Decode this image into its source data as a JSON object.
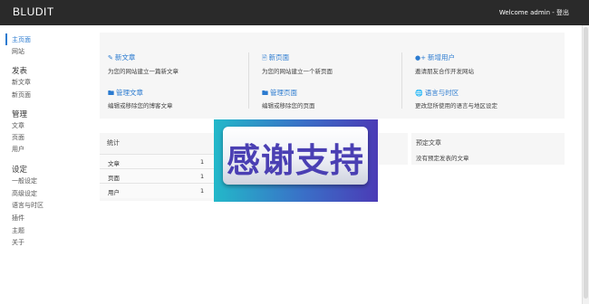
{
  "header": {
    "brand": "BLUDIT",
    "welcome_text": "Welcome admin - ",
    "logout_label": "登出"
  },
  "sidebar": {
    "items": [
      {
        "label": "主页面",
        "active": true
      },
      {
        "label": "网站"
      },
      {
        "label": "发表",
        "heading": true
      },
      {
        "label": "新文章"
      },
      {
        "label": "新页面"
      },
      {
        "label": "管理",
        "heading": true
      },
      {
        "label": "文章"
      },
      {
        "label": "页面"
      },
      {
        "label": "用户"
      },
      {
        "label": "设定",
        "heading": true
      },
      {
        "label": "一般设定"
      },
      {
        "label": "高级设定"
      },
      {
        "label": "语言与时区"
      },
      {
        "label": "插件"
      },
      {
        "label": "主题"
      },
      {
        "label": "关于"
      }
    ]
  },
  "quick_links": [
    {
      "title": "新文章",
      "icon": "pencil-icon",
      "desc": "为您的网站建立一篇新文章"
    },
    {
      "title": "新页面",
      "icon": "file-icon",
      "desc": "为您的网站建立一个新页面"
    },
    {
      "title": "新增用户",
      "icon": "user-plus-icon",
      "desc": "邀请朋友合作开发网站"
    },
    {
      "title": "管理文章",
      "icon": "folder-icon",
      "desc": "编辑或移除您的博客文章"
    },
    {
      "title": "管理页面",
      "icon": "folder-icon",
      "desc": "编辑或移除您的页面"
    },
    {
      "title": "语言与时区",
      "icon": "globe-icon",
      "desc": "更改您所使用的语言与地区设定"
    }
  ],
  "stats": {
    "title": "统计",
    "rows": [
      {
        "label": "文章",
        "value": "1"
      },
      {
        "label": "页面",
        "value": "1"
      },
      {
        "label": "用户",
        "value": "1"
      }
    ]
  },
  "scheduled": {
    "title": "预定文章",
    "empty_text": "没有预定发表的文章"
  },
  "overlay": {
    "text": "感谢支持"
  },
  "colors": {
    "accent": "#2b7bd0",
    "topbar": "#2a2a2a",
    "panel": "#f6f6f6"
  }
}
